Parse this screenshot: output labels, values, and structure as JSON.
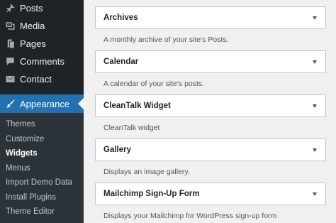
{
  "sidebar": {
    "items": [
      {
        "label": "Posts",
        "icon": "pushpin-icon"
      },
      {
        "label": "Media",
        "icon": "media-icon"
      },
      {
        "label": "Pages",
        "icon": "pages-icon"
      },
      {
        "label": "Comments",
        "icon": "comments-icon"
      },
      {
        "label": "Contact",
        "icon": "contact-icon"
      }
    ],
    "active": {
      "label": "Appearance",
      "icon": "paintbrush-icon"
    },
    "submenu": [
      {
        "label": "Themes",
        "current": false
      },
      {
        "label": "Customize",
        "current": false
      },
      {
        "label": "Widgets",
        "current": true
      },
      {
        "label": "Menus",
        "current": false
      },
      {
        "label": "Import Demo Data",
        "current": false
      },
      {
        "label": "Install Plugins",
        "current": false
      },
      {
        "label": "Theme Editor",
        "current": false
      }
    ]
  },
  "widgets": [
    {
      "title": "Archives",
      "description": "A monthly archive of your site's Posts."
    },
    {
      "title": "Calendar",
      "description": "A calendar of your site's posts."
    },
    {
      "title": "CleanTalk Widget",
      "description": "CleanTalk widget"
    },
    {
      "title": "Gallery",
      "description": "Displays an image gallery."
    },
    {
      "title": "Mailchimp Sign-Up Form",
      "description": "Displays your Mailchimp for WordPress sign-up form"
    }
  ],
  "colors": {
    "sidebar_bg": "#1d2327",
    "submenu_bg": "#2c3338",
    "accent": "#2271b1",
    "main_bg": "#f0f0f1"
  }
}
